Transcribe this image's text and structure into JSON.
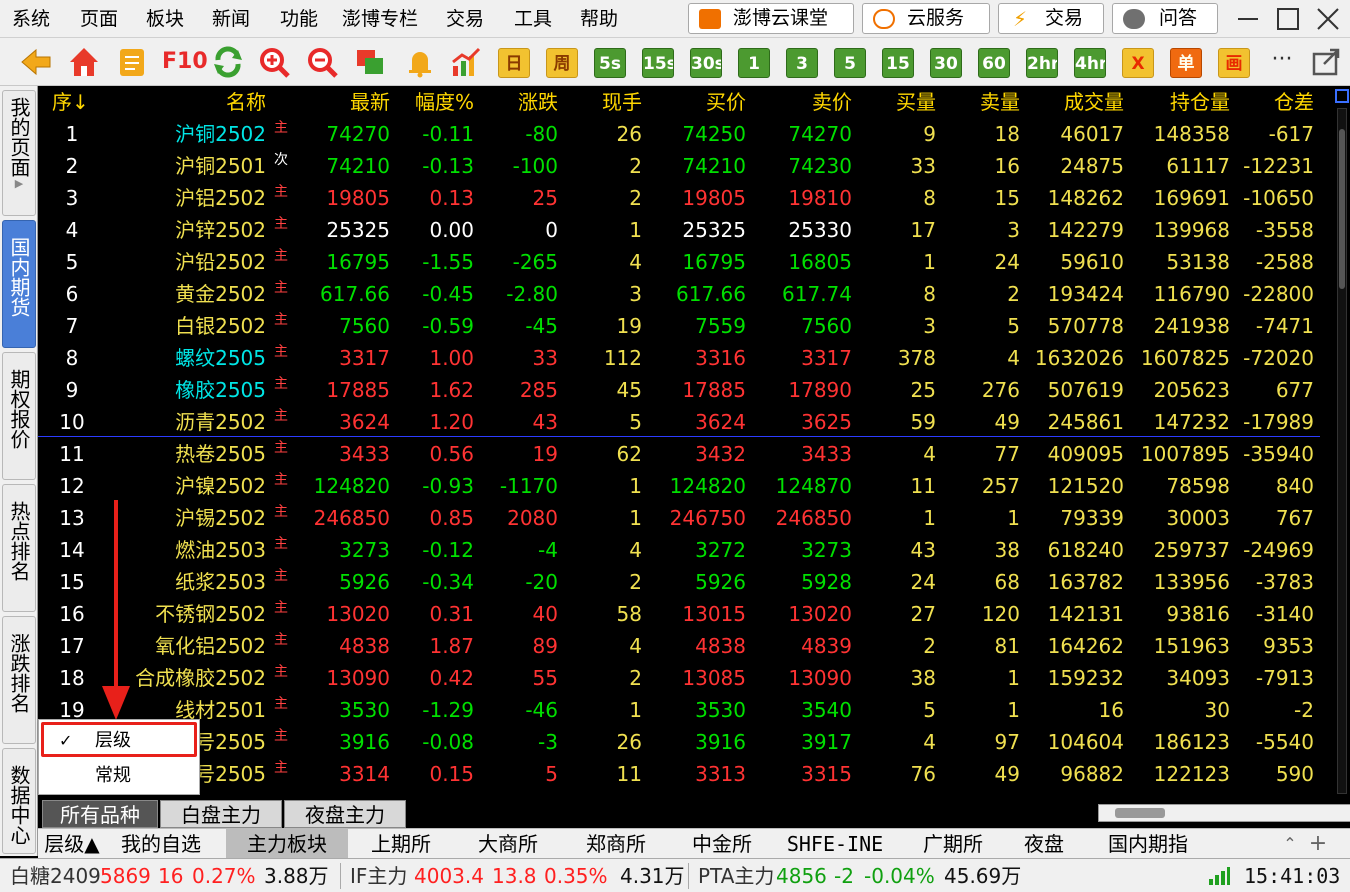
{
  "menubar": {
    "items": [
      "系统",
      "页面",
      "板块",
      "新闻",
      "功能",
      "澎博专栏",
      "交易",
      "工具",
      "帮助"
    ],
    "buttons": [
      {
        "label": "澎博云课堂",
        "icon": "video-lesson-icon",
        "color": "#f07000"
      },
      {
        "label": "云服务",
        "icon": "cloud-icon",
        "color": "#f07000"
      },
      {
        "label": "交易",
        "icon": "lightning-icon",
        "color": "#f0a000"
      },
      {
        "label": "问答",
        "icon": "chat-icon",
        "color": "#707070"
      }
    ]
  },
  "toolbar": {
    "icons": [
      "back-arrow-icon",
      "home-icon",
      "notepad-icon",
      "f10-icon",
      "refresh-icon",
      "zoom-in-icon",
      "zoom-out-icon",
      "windows-icon",
      "alert-bell-icon",
      "chart-trend-icon"
    ],
    "f10_label": "F10",
    "periods": [
      {
        "label": "日",
        "style": "yellow"
      },
      {
        "label": "周",
        "style": "yellow"
      },
      {
        "label": "5s",
        "style": "green"
      },
      {
        "label": "15s",
        "style": "green"
      },
      {
        "label": "30s",
        "style": "green"
      },
      {
        "label": "1",
        "style": "green"
      },
      {
        "label": "3",
        "style": "green"
      },
      {
        "label": "5",
        "style": "green"
      },
      {
        "label": "15",
        "style": "green"
      },
      {
        "label": "30",
        "style": "green"
      },
      {
        "label": "60",
        "style": "green"
      },
      {
        "label": "2hr",
        "style": "green"
      },
      {
        "label": "4hr",
        "style": "green"
      },
      {
        "label": "X",
        "style": "yellow"
      },
      {
        "label": "单",
        "style": "orange"
      },
      {
        "label": "画",
        "style": "yellow"
      }
    ],
    "more_label": "···"
  },
  "sidetabs": [
    {
      "label": "我的页面",
      "active": false,
      "arrow": "▶"
    },
    {
      "label": "国内期货",
      "active": true
    },
    {
      "label": "期权报价",
      "active": false
    },
    {
      "label": "热点排名",
      "active": false
    },
    {
      "label": "涨跌排名",
      "active": false
    },
    {
      "label": "数据中心",
      "active": false
    }
  ],
  "grid": {
    "headers": [
      "序↓",
      "名称",
      "最新",
      "幅度%",
      "涨跌",
      "现手",
      "买价",
      "卖价",
      "买量",
      "卖量",
      "成交量",
      "持仓量",
      "仓差"
    ],
    "rows": [
      {
        "seq": "1",
        "name": "沪铜2502",
        "tag": "主",
        "nameColor": "cyan",
        "last": "74270",
        "pct": "-0.11",
        "chg": "-80",
        "vol": "26",
        "bid": "74250",
        "ask": "74270",
        "bidv": "9",
        "askv": "18",
        "turnover": "46017",
        "oi": "148358",
        "oichg": "-617",
        "dir": "down"
      },
      {
        "seq": "2",
        "name": "沪铜2501",
        "tag": "次",
        "nameColor": "yellow",
        "last": "74210",
        "pct": "-0.13",
        "chg": "-100",
        "vol": "2",
        "bid": "74210",
        "ask": "74230",
        "bidv": "33",
        "askv": "16",
        "turnover": "24875",
        "oi": "61117",
        "oichg": "-12231",
        "dir": "down"
      },
      {
        "seq": "3",
        "name": "沪铝2502",
        "tag": "主",
        "nameColor": "yellow",
        "last": "19805",
        "pct": "0.13",
        "chg": "25",
        "vol": "2",
        "bid": "19805",
        "ask": "19810",
        "bidv": "8",
        "askv": "15",
        "turnover": "148262",
        "oi": "169691",
        "oichg": "-10650",
        "dir": "up"
      },
      {
        "seq": "4",
        "name": "沪锌2502",
        "tag": "主",
        "nameColor": "yellow",
        "last": "25325",
        "pct": "0.00",
        "chg": "0",
        "vol": "1",
        "bid": "25325",
        "ask": "25330",
        "bidv": "17",
        "askv": "3",
        "turnover": "142279",
        "oi": "139968",
        "oichg": "-3558",
        "dir": "flat"
      },
      {
        "seq": "5",
        "name": "沪铅2502",
        "tag": "主",
        "nameColor": "yellow",
        "last": "16795",
        "pct": "-1.55",
        "chg": "-265",
        "vol": "4",
        "bid": "16795",
        "ask": "16805",
        "bidv": "1",
        "askv": "24",
        "turnover": "59610",
        "oi": "53138",
        "oichg": "-2588",
        "dir": "down"
      },
      {
        "seq": "6",
        "name": "黄金2502",
        "tag": "主",
        "nameColor": "yellow",
        "last": "617.66",
        "pct": "-0.45",
        "chg": "-2.80",
        "vol": "3",
        "bid": "617.66",
        "ask": "617.74",
        "bidv": "8",
        "askv": "2",
        "turnover": "193424",
        "oi": "116790",
        "oichg": "-22800",
        "dir": "down"
      },
      {
        "seq": "7",
        "name": "白银2502",
        "tag": "主",
        "nameColor": "yellow",
        "last": "7560",
        "pct": "-0.59",
        "chg": "-45",
        "vol": "19",
        "bid": "7559",
        "ask": "7560",
        "bidv": "3",
        "askv": "5",
        "turnover": "570778",
        "oi": "241938",
        "oichg": "-7471",
        "dir": "down"
      },
      {
        "seq": "8",
        "name": "螺纹2505",
        "tag": "主",
        "nameColor": "cyan",
        "last": "3317",
        "pct": "1.00",
        "chg": "33",
        "vol": "112",
        "bid": "3316",
        "ask": "3317",
        "bidv": "378",
        "askv": "4",
        "turnover": "1632026",
        "oi": "1607825",
        "oichg": "-72020",
        "dir": "up"
      },
      {
        "seq": "9",
        "name": "橡胶2505",
        "tag": "主",
        "nameColor": "cyan",
        "last": "17885",
        "pct": "1.62",
        "chg": "285",
        "vol": "45",
        "bid": "17885",
        "ask": "17890",
        "bidv": "25",
        "askv": "276",
        "turnover": "507619",
        "oi": "205623",
        "oichg": "677",
        "dir": "up"
      },
      {
        "seq": "10",
        "name": "沥青2502",
        "tag": "主",
        "nameColor": "yellow",
        "last": "3624",
        "pct": "1.20",
        "chg": "43",
        "vol": "5",
        "bid": "3624",
        "ask": "3625",
        "bidv": "59",
        "askv": "49",
        "turnover": "245861",
        "oi": "147232",
        "oichg": "-17989",
        "dir": "up"
      },
      {
        "seq": "11",
        "name": "热卷2505",
        "tag": "主",
        "nameColor": "yellow",
        "last": "3433",
        "pct": "0.56",
        "chg": "19",
        "vol": "62",
        "bid": "3432",
        "ask": "3433",
        "bidv": "4",
        "askv": "77",
        "turnover": "409095",
        "oi": "1007895",
        "oichg": "-35940",
        "dir": "up"
      },
      {
        "seq": "12",
        "name": "沪镍2502",
        "tag": "主",
        "nameColor": "yellow",
        "last": "124820",
        "pct": "-0.93",
        "chg": "-1170",
        "vol": "1",
        "bid": "124820",
        "ask": "124870",
        "bidv": "11",
        "askv": "257",
        "turnover": "121520",
        "oi": "78598",
        "oichg": "840",
        "dir": "down"
      },
      {
        "seq": "13",
        "name": "沪锡2502",
        "tag": "主",
        "nameColor": "yellow",
        "last": "246850",
        "pct": "0.85",
        "chg": "2080",
        "vol": "1",
        "bid": "246750",
        "ask": "246850",
        "bidv": "1",
        "askv": "1",
        "turnover": "79339",
        "oi": "30003",
        "oichg": "767",
        "dir": "up"
      },
      {
        "seq": "14",
        "name": "燃油2503",
        "tag": "主",
        "nameColor": "yellow",
        "last": "3273",
        "pct": "-0.12",
        "chg": "-4",
        "vol": "4",
        "bid": "3272",
        "ask": "3273",
        "bidv": "43",
        "askv": "38",
        "turnover": "618240",
        "oi": "259737",
        "oichg": "-24969",
        "dir": "down"
      },
      {
        "seq": "15",
        "name": "纸浆2503",
        "tag": "主",
        "nameColor": "yellow",
        "last": "5926",
        "pct": "-0.34",
        "chg": "-20",
        "vol": "2",
        "bid": "5926",
        "ask": "5928",
        "bidv": "24",
        "askv": "68",
        "turnover": "163782",
        "oi": "133956",
        "oichg": "-3783",
        "dir": "down"
      },
      {
        "seq": "16",
        "name": "不锈钢2502",
        "tag": "主",
        "nameColor": "yellow",
        "last": "13020",
        "pct": "0.31",
        "chg": "40",
        "vol": "58",
        "bid": "13015",
        "ask": "13020",
        "bidv": "27",
        "askv": "120",
        "turnover": "142131",
        "oi": "93816",
        "oichg": "-3140",
        "dir": "up"
      },
      {
        "seq": "17",
        "name": "氧化铝2502",
        "tag": "主",
        "nameColor": "yellow",
        "last": "4838",
        "pct": "1.87",
        "chg": "89",
        "vol": "4",
        "bid": "4838",
        "ask": "4839",
        "bidv": "2",
        "askv": "81",
        "turnover": "164262",
        "oi": "151963",
        "oichg": "9353",
        "dir": "up"
      },
      {
        "seq": "18",
        "name": "合成橡胶2502",
        "tag": "主",
        "nameColor": "yellow",
        "last": "13090",
        "pct": "0.42",
        "chg": "55",
        "vol": "2",
        "bid": "13085",
        "ask": "13090",
        "bidv": "38",
        "askv": "1",
        "turnover": "159232",
        "oi": "34093",
        "oichg": "-7913",
        "dir": "up"
      },
      {
        "seq": "19",
        "name": "线材2501",
        "tag": "主",
        "nameColor": "yellow",
        "last": "3530",
        "pct": "-1.29",
        "chg": "-46",
        "vol": "1",
        "bid": "3530",
        "ask": "3540",
        "bidv": "5",
        "askv": "1",
        "turnover": "16",
        "oi": "30",
        "oichg": "-2",
        "dir": "down"
      },
      {
        "seq": "",
        "name": "胶合板2505",
        "tag": "主",
        "nameColor": "yellow",
        "last": "3916",
        "pct": "-0.08",
        "chg": "-3",
        "vol": "26",
        "bid": "3916",
        "ask": "3917",
        "bidv": "4",
        "askv": "97",
        "turnover": "104604",
        "oi": "186123",
        "oichg": "-5540",
        "dir": "down",
        "nameVisible": "号2505"
      },
      {
        "seq": "",
        "name": "丁二烯橡胶2505",
        "tag": "主",
        "nameColor": "yellow",
        "last": "3314",
        "pct": "0.15",
        "chg": "5",
        "vol": "11",
        "bid": "3313",
        "ask": "3315",
        "bidv": "76",
        "askv": "49",
        "turnover": "96882",
        "oi": "122123",
        "oichg": "590",
        "dir": "up",
        "nameVisible": "号2505"
      }
    ]
  },
  "ctxmenu": {
    "items": [
      {
        "label": "层级",
        "checked": true
      },
      {
        "label": "常规",
        "checked": false
      }
    ],
    "check_mark": "✓"
  },
  "cattabs": [
    {
      "label": "所有品种",
      "active": true
    },
    {
      "label": "白盘主力",
      "active": false
    },
    {
      "label": "夜盘主力",
      "active": false
    }
  ],
  "exchtabs": [
    {
      "label": "层级▲",
      "active": false
    },
    {
      "label": "我的自选",
      "active": false
    },
    {
      "label": "主力板块",
      "active": true
    },
    {
      "label": "上期所",
      "active": false
    },
    {
      "label": "大商所",
      "active": false
    },
    {
      "label": "郑商所",
      "active": false
    },
    {
      "label": "中金所",
      "active": false
    },
    {
      "label": "SHFE-INE",
      "active": false
    },
    {
      "label": "广期所",
      "active": false
    },
    {
      "label": "夜盘",
      "active": false
    },
    {
      "label": "国内期指",
      "active": false
    }
  ],
  "exch_extra": {
    "collapse": "⌃",
    "add": "+"
  },
  "statusbar": {
    "quotes": [
      {
        "name": "白糖2409",
        "price": "5869",
        "chg": "16",
        "pct": "0.27%",
        "amt": "3.88万",
        "dir": "up"
      },
      {
        "name": "IF主力",
        "price": "4003.4",
        "chg": "13.8",
        "pct": "0.35%",
        "amt": "4.31万",
        "dir": "up"
      },
      {
        "name": "PTA主力",
        "price": "4856",
        "chg": "-2",
        "pct": "-0.04%",
        "amt": "45.69万",
        "dir": "down"
      }
    ],
    "time": "15:41:03"
  },
  "colors": {
    "up": "#ff3333",
    "down": "#00e000",
    "flat": "#ffffff",
    "header": "#ffd700",
    "cyan": "#00e6e6",
    "yellow": "#f0e050"
  }
}
